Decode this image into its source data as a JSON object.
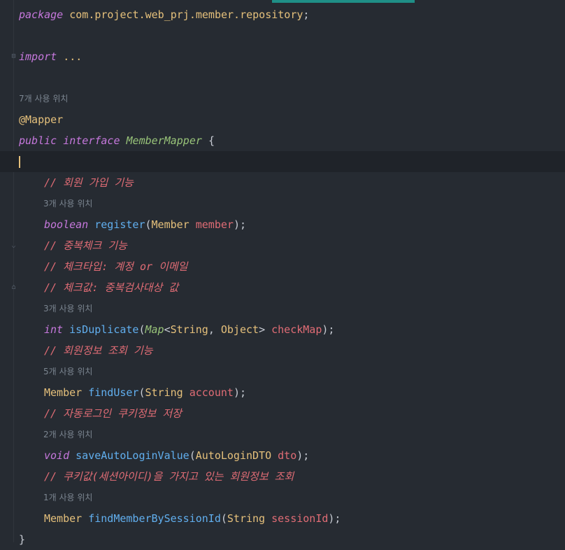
{
  "editor": {
    "accent_color": "#1f8f87",
    "lines": {
      "package": {
        "kw": "package",
        "path": "com.project.web_prj.member.repository",
        "semi": ";"
      },
      "import": {
        "kw": "import",
        "ellipsis": "..."
      },
      "hint_interface": "7개 사용 위치",
      "annotation": "@Mapper",
      "decl": {
        "public": "public",
        "interface": "interface",
        "name": "MemberMapper",
        "brace": "{"
      },
      "c1": "// 회원 가입 기능",
      "hint_register": "3개 사용 위치",
      "register": {
        "ret": "boolean",
        "name": "register",
        "open": "(",
        "ptype": "Member",
        "pname": "member",
        "close": ");"
      },
      "c2": "// 중복체크 기능",
      "c3": "// 체크타입: 계정 or 이메일",
      "c4": "// 체크값: 중복검사대상 값",
      "hint_dup": "3개 사용 위치",
      "dup": {
        "ret": "int",
        "name": "isDuplicate",
        "open": "(",
        "map": "Map",
        "lt": "<",
        "t1": "String",
        "comma": ", ",
        "t2": "Object",
        "gt": ">",
        "pname": "checkMap",
        "close": ");"
      },
      "c5": "// 회원정보 조회 기능",
      "hint_find": "5개 사용 위치",
      "find": {
        "ret": "Member",
        "name": "findUser",
        "open": "(",
        "ptype": "String",
        "pname": "account",
        "close": ");"
      },
      "c6": "// 자동로그인 쿠키정보 저장",
      "hint_save": "2개 사용 위치",
      "save": {
        "ret": "void",
        "name": "saveAutoLoginValue",
        "open": "(",
        "ptype": "AutoLoginDTO",
        "pname": "dto",
        "close": ");"
      },
      "c7": "// 쿠키값(세션아이디)을 가지고 있는 회원정보 조회",
      "hint_session": "1개 사용 위치",
      "session": {
        "ret": "Member",
        "name": "findMemberBySessionId",
        "open": "(",
        "ptype": "String",
        "pname": "sessionId",
        "close": ");"
      },
      "end": "}"
    }
  }
}
